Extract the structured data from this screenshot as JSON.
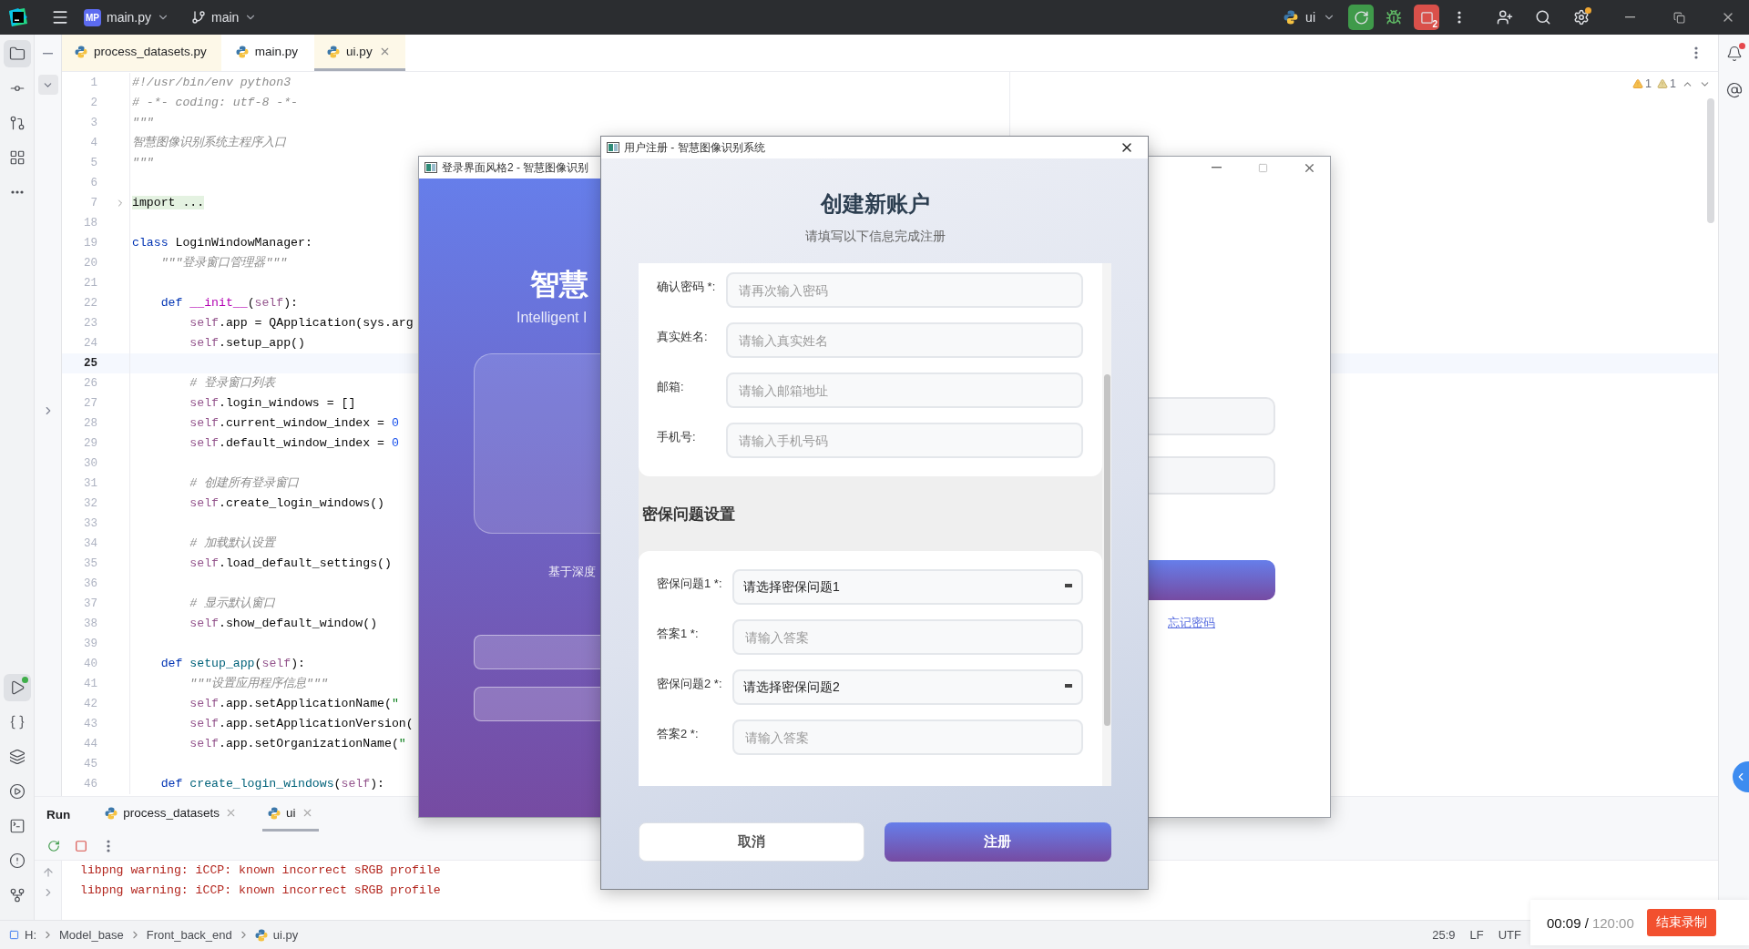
{
  "ide": {
    "title_bar": {
      "project_badge": "MP",
      "file": "main.py",
      "branch": "main",
      "run_config": "ui",
      "stop_count": "2"
    },
    "left_tools": [
      {
        "kind": "folder",
        "selected": true
      },
      {
        "kind": "commit",
        "selected": false
      },
      {
        "kind": "pull_requests",
        "selected": false
      },
      {
        "kind": "structure",
        "selected": false
      },
      {
        "kind": "more",
        "selected": false
      },
      {
        "kind": "run",
        "selected": true
      },
      {
        "kind": "console",
        "selected": false
      },
      {
        "kind": "layers",
        "selected": false
      },
      {
        "kind": "services",
        "selected": false
      },
      {
        "kind": "terminal",
        "selected": false
      },
      {
        "kind": "problems",
        "selected": false
      },
      {
        "kind": "git",
        "selected": false
      }
    ],
    "editor_tabs": [
      {
        "label": "process_datasets.py",
        "selected": false,
        "tinted": true
      },
      {
        "label": "main.py",
        "selected": false,
        "tinted": false
      },
      {
        "label": "ui.py",
        "selected": true,
        "tinted": true
      }
    ],
    "warnings": [
      "1",
      "1"
    ],
    "code_lines": [
      {
        "number": "1",
        "current": false,
        "tokens": [
          {
            "kind": "comment",
            "text": "#!/usr/bin/env python3"
          }
        ]
      },
      {
        "number": "2",
        "current": false,
        "tokens": [
          {
            "kind": "comment",
            "text": "# -*- coding: utf-8 -*-"
          }
        ]
      },
      {
        "number": "3",
        "current": false,
        "tokens": [
          {
            "kind": "doc",
            "text": "\"\"\""
          }
        ]
      },
      {
        "number": "4",
        "current": false,
        "tokens": [
          {
            "kind": "doc",
            "text": "智慧图像识别系统主程序入口"
          }
        ]
      },
      {
        "number": "5",
        "current": false,
        "tokens": [
          {
            "kind": "doc",
            "text": "\"\"\""
          }
        ]
      },
      {
        "number": "6",
        "current": false
      },
      {
        "number": "7",
        "current": false,
        "tokens": [
          {
            "kind": "folded",
            "text": "import ..."
          }
        ]
      },
      {
        "number": "18",
        "current": false
      },
      {
        "number": "19",
        "current": false,
        "tokens": [
          {
            "kind": "keyword",
            "text": "class"
          },
          {
            "kind": "plain",
            "text": " LoginWindowManager:"
          }
        ]
      },
      {
        "number": "20",
        "current": false,
        "tokens": [
          {
            "kind": "doc",
            "text": "    \"\"\"登录窗口管理器\"\"\""
          }
        ]
      },
      {
        "number": "21",
        "current": false
      },
      {
        "number": "22",
        "current": false,
        "tokens": [
          {
            "kind": "keyword",
            "text": "    def "
          },
          {
            "kind": "magic",
            "text": "__init__"
          },
          {
            "kind": "plain",
            "text": "("
          },
          {
            "kind": "self",
            "text": "self"
          },
          {
            "kind": "plain",
            "text": "):"
          }
        ]
      },
      {
        "number": "23",
        "current": false,
        "tokens": [
          {
            "kind": "self",
            "text": "        self"
          },
          {
            "kind": "plain",
            "text": ".app = QApplication(sys.arg"
          }
        ]
      },
      {
        "number": "24",
        "current": false,
        "tokens": [
          {
            "kind": "self",
            "text": "        self"
          },
          {
            "kind": "plain",
            "text": ".setup_app()"
          }
        ]
      },
      {
        "number": "25",
        "current": true
      },
      {
        "number": "26",
        "current": false,
        "tokens": [
          {
            "kind": "comment",
            "text": "        # 登录窗口列表"
          }
        ]
      },
      {
        "number": "27",
        "current": false,
        "tokens": [
          {
            "kind": "self",
            "text": "        self"
          },
          {
            "kind": "plain",
            "text": ".login_windows = []"
          }
        ]
      },
      {
        "number": "28",
        "current": false,
        "tokens": [
          {
            "kind": "self",
            "text": "        self"
          },
          {
            "kind": "plain",
            "text": ".current_window_index = "
          },
          {
            "kind": "number",
            "text": "0"
          }
        ]
      },
      {
        "number": "29",
        "current": false,
        "tokens": [
          {
            "kind": "self",
            "text": "        self"
          },
          {
            "kind": "plain",
            "text": ".default_window_index = "
          },
          {
            "kind": "number",
            "text": "0"
          }
        ]
      },
      {
        "number": "30",
        "current": false
      },
      {
        "number": "31",
        "current": false,
        "tokens": [
          {
            "kind": "comment",
            "text": "        # 创建所有登录窗口"
          }
        ]
      },
      {
        "number": "32",
        "current": false,
        "tokens": [
          {
            "kind": "self",
            "text": "        self"
          },
          {
            "kind": "plain",
            "text": ".create_login_windows()"
          }
        ]
      },
      {
        "number": "33",
        "current": false
      },
      {
        "number": "34",
        "current": false,
        "tokens": [
          {
            "kind": "comment",
            "text": "        # 加载默认设置"
          }
        ]
      },
      {
        "number": "35",
        "current": false,
        "tokens": [
          {
            "kind": "self",
            "text": "        self"
          },
          {
            "kind": "plain",
            "text": ".load_default_settings()"
          }
        ]
      },
      {
        "number": "36",
        "current": false
      },
      {
        "number": "37",
        "current": false,
        "tokens": [
          {
            "kind": "comment",
            "text": "        # 显示默认窗口"
          }
        ]
      },
      {
        "number": "38",
        "current": false,
        "tokens": [
          {
            "kind": "self",
            "text": "        self"
          },
          {
            "kind": "plain",
            "text": ".show_default_window()"
          }
        ]
      },
      {
        "number": "39",
        "current": false
      },
      {
        "number": "40",
        "current": false,
        "tokens": [
          {
            "kind": "keyword",
            "text": "    def "
          },
          {
            "kind": "funcdef",
            "text": "setup_app"
          },
          {
            "kind": "plain",
            "text": "("
          },
          {
            "kind": "self",
            "text": "self"
          },
          {
            "kind": "plain",
            "text": "):"
          }
        ]
      },
      {
        "number": "41",
        "current": false,
        "tokens": [
          {
            "kind": "doc",
            "text": "        \"\"\"设置应用程序信息\"\"\""
          }
        ]
      },
      {
        "number": "42",
        "current": false,
        "tokens": [
          {
            "kind": "self",
            "text": "        self"
          },
          {
            "kind": "plain",
            "text": ".app.setApplicationName("
          },
          {
            "kind": "string",
            "text": "\""
          }
        ]
      },
      {
        "number": "43",
        "current": false,
        "tokens": [
          {
            "kind": "self",
            "text": "        self"
          },
          {
            "kind": "plain",
            "text": ".app.setApplicationVersion("
          }
        ]
      },
      {
        "number": "44",
        "current": false,
        "tokens": [
          {
            "kind": "self",
            "text": "        self"
          },
          {
            "kind": "plain",
            "text": ".app.setOrganizationName("
          },
          {
            "kind": "string",
            "text": "\""
          }
        ]
      },
      {
        "number": "45",
        "current": false
      },
      {
        "number": "46",
        "current": false,
        "tokens": [
          {
            "kind": "keyword",
            "text": "    def "
          },
          {
            "kind": "funcdef",
            "text": "create_login_windows"
          },
          {
            "kind": "plain",
            "text": "("
          },
          {
            "kind": "self",
            "text": "self"
          },
          {
            "kind": "plain",
            "text": "):"
          }
        ]
      }
    ],
    "run_panel": {
      "title": "Run",
      "tabs": [
        {
          "label": "process_datasets",
          "selected": false
        },
        {
          "label": "ui",
          "selected": true
        }
      ],
      "output": [
        "libpng warning: iCCP: known incorrect sRGB profile",
        "libpng warning: iCCP: known incorrect sRGB profile"
      ]
    },
    "breadcrumbs": [
      "H:",
      "Model_base",
      "Front_back_end",
      "ui.py"
    ],
    "status": [
      "25:9",
      "LF",
      "UTF"
    ]
  },
  "login_window": {
    "title": "登录界面风格2 - 智慧图像识别",
    "brand_title": "智慧",
    "brand_subtitle": "Intelligent I",
    "tagline": "基于深度",
    "link": "忘记密码"
  },
  "register_dialog": {
    "title": "用户注册 - 智慧图像识别系统",
    "heading": "创建新账户",
    "subtitle": "请填写以下信息完成注册",
    "account_fields": [
      {
        "kind": "text",
        "label": "确认密码 *:",
        "placeholder": "请再次输入密码"
      },
      {
        "kind": "text",
        "label": "真实姓名:",
        "placeholder": "请输入真实姓名"
      },
      {
        "kind": "text",
        "label": "邮箱:",
        "placeholder": "请输入邮箱地址"
      },
      {
        "kind": "text",
        "label": "手机号:",
        "placeholder": "请输入手机号码"
      }
    ],
    "security_heading": "密保问题设置",
    "security_fields": [
      {
        "kind": "select",
        "label": "密保问题1 *:",
        "value": "请选择密保问题1"
      },
      {
        "kind": "text",
        "label": "答案1 *:",
        "placeholder": "请输入答案"
      },
      {
        "kind": "select",
        "label": "密保问题2 *:",
        "value": "请选择密保问题2"
      },
      {
        "kind": "text",
        "label": "答案2 *:",
        "placeholder": "请输入答案"
      }
    ],
    "buttons": [
      {
        "kind": "secondary",
        "label": "取消"
      },
      {
        "kind": "primary",
        "label": "注册"
      }
    ]
  },
  "recorder": {
    "elapsed": "00:09 /",
    "limit": "120:00",
    "stop_label": "结束录制"
  }
}
